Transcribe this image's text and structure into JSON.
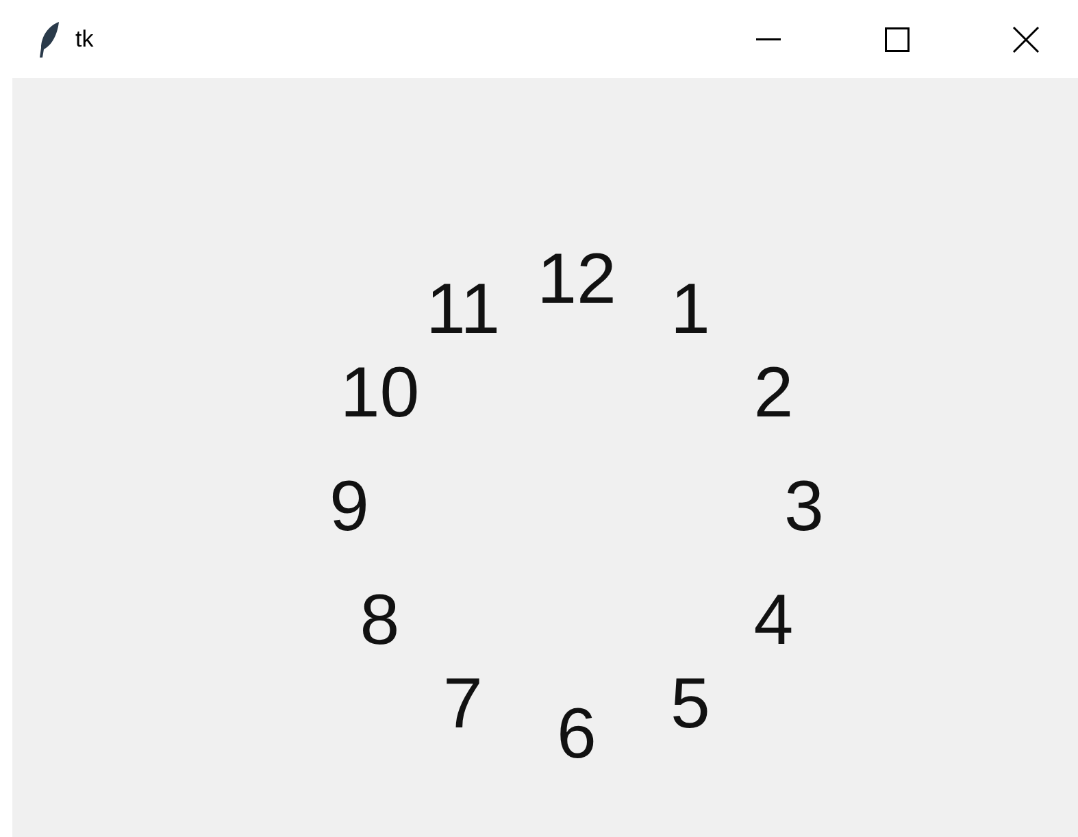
{
  "window": {
    "title": "tk"
  },
  "clock": {
    "numbers": [
      "12",
      "11",
      "1",
      "10",
      "2",
      "9",
      "3",
      "8",
      "4",
      "7",
      "5",
      "6"
    ]
  }
}
